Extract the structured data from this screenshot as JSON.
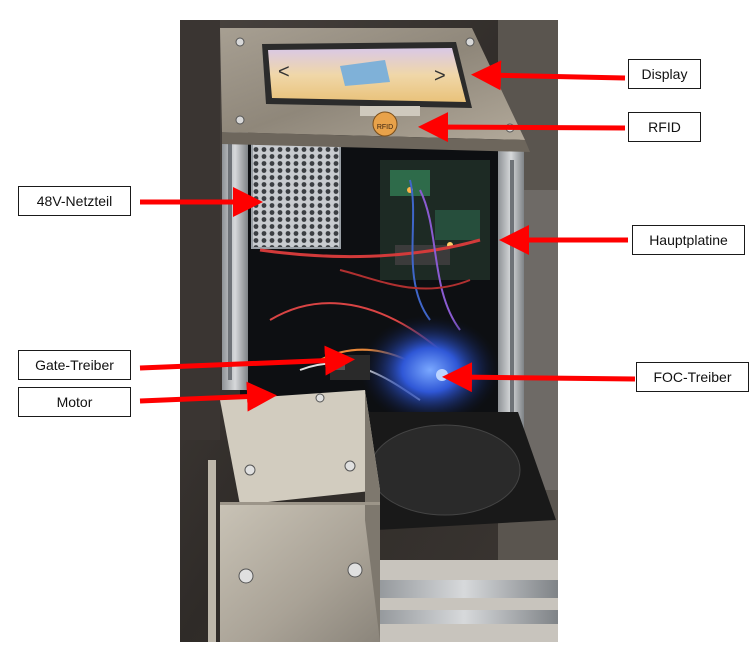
{
  "photo": {
    "description_icon": "device-photo",
    "screen_text_small": "RFID"
  },
  "labels": {
    "display": "Display",
    "rfid": "RFID",
    "netzteil": "48V-Netzteil",
    "hauptplatine": "Hauptplatine",
    "gate_treiber": "Gate-Treiber",
    "foc_treiber": "FOC-Treiber",
    "motor": "Motor"
  },
  "colors": {
    "arrow": "#ff0000",
    "label_border": "#1a1a1a"
  }
}
